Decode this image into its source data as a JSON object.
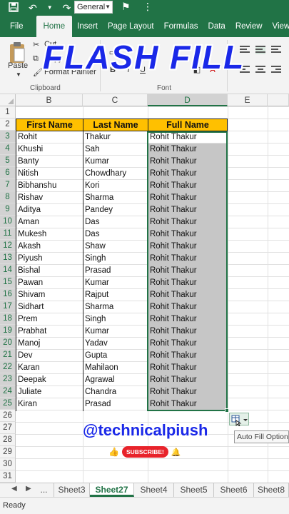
{
  "qat": {
    "number_format": "General"
  },
  "tabs": [
    "File",
    "Home",
    "Insert",
    "Page Layout",
    "Formulas",
    "Data",
    "Review",
    "View"
  ],
  "ribbon": {
    "paste": "Paste",
    "cut": "Cut",
    "copy": "Copy",
    "format_painter": "Format Painter",
    "clipboard_group": "Clipboard",
    "font_group": "Font",
    "bold": "B",
    "italic": "I",
    "underline": "U"
  },
  "overlay_title": "FLASH FILL",
  "columns": [
    "B",
    "C",
    "D",
    "E"
  ],
  "rows": [
    "1",
    "2",
    "3",
    "4",
    "5",
    "6",
    "7",
    "8",
    "9",
    "10",
    "11",
    "12",
    "13",
    "14",
    "15",
    "16",
    "17",
    "18",
    "19",
    "20",
    "21",
    "22",
    "23",
    "24",
    "25",
    "26",
    "27",
    "28",
    "29",
    "30",
    "31"
  ],
  "table": {
    "headers": [
      "First Name",
      "Last Name",
      "Full Name"
    ],
    "first_names": [
      "Rohit",
      "Khushi",
      "Banty",
      "Nitish",
      "Bibhanshu",
      "Rishav",
      "Aditya",
      "Aman",
      "Mukesh",
      "Akash",
      "Piyush",
      "Bishal",
      "Pawan",
      "Shivam",
      "Sidhart",
      "Prem",
      "Prabhat",
      "Manoj",
      "Dev",
      "Karan",
      "Deepak",
      "Juliate",
      "Kiran"
    ],
    "last_names": [
      "Thakur",
      "Sah",
      "Kumar",
      "Chowdhary",
      " Kori",
      " Sharma",
      "Pandey",
      " Das",
      " Das",
      " Shaw",
      " Singh",
      " Prasad",
      "Kumar",
      "Rajput",
      "Sharma",
      "Singh",
      "Kumar",
      "Yadav",
      "Gupta",
      "Mahilaon",
      "Agrawal",
      "Chandra",
      "Prasad"
    ],
    "full_names": [
      "Rohit Thakur",
      "Rohit Thakur",
      "Rohit Thakur",
      "Rohit Thakur",
      "Rohit Thakur",
      "Rohit Thakur",
      "Rohit Thakur",
      "Rohit Thakur",
      "Rohit Thakur",
      "Rohit Thakur",
      "Rohit Thakur",
      "Rohit Thakur",
      "Rohit Thakur",
      "Rohit Thakur",
      "Rohit Thakur",
      "Rohit Thakur",
      "Rohit Thakur",
      "Rohit Thakur",
      "Rohit Thakur",
      "Rohit Thakur",
      "Rohit Thakur",
      "Rohit Thakur",
      "Rohit Thakur"
    ]
  },
  "autofill": {
    "tooltip": "Auto Fill Options"
  },
  "watermark": {
    "handle": "@technicalpiush",
    "subscribe": "SUBSCRIBE!"
  },
  "sheets": [
    "...",
    "Sheet3",
    "Sheet27",
    "Sheet4",
    "Sheet5",
    "Sheet6",
    "Sheet8"
  ],
  "active_sheet": "Sheet27",
  "status": "Ready",
  "colors": {
    "excel_green": "#217346",
    "header_fill": "#ffc000",
    "title_blue": "#1a28e8"
  }
}
